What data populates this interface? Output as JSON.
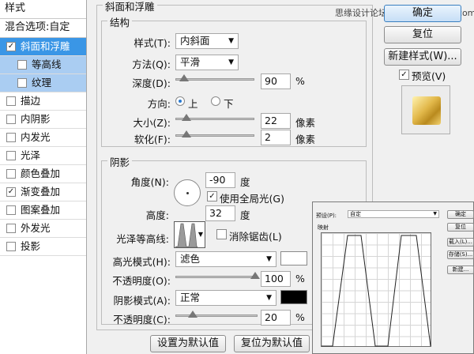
{
  "sidebar": {
    "title": "样式",
    "blend_options": "混合选项:自定",
    "items": [
      {
        "label": "斜面和浮雕",
        "checked": "✓"
      },
      {
        "label": "等高线",
        "checked": ""
      },
      {
        "label": "纹理",
        "checked": ""
      },
      {
        "label": "描边",
        "checked": ""
      },
      {
        "label": "内阴影",
        "checked": ""
      },
      {
        "label": "内发光",
        "checked": ""
      },
      {
        "label": "光泽",
        "checked": ""
      },
      {
        "label": "颜色叠加",
        "checked": ""
      },
      {
        "label": "渐变叠加",
        "checked": "✓"
      },
      {
        "label": "图案叠加",
        "checked": ""
      },
      {
        "label": "外发光",
        "checked": ""
      },
      {
        "label": "投影",
        "checked": ""
      }
    ]
  },
  "bevel": {
    "title": "斜面和浮雕",
    "structure_title": "结构",
    "style_label": "样式(T):",
    "style_value": "内斜面",
    "technique_label": "方法(Q):",
    "technique_value": "平滑",
    "depth_label": "深度(D):",
    "depth_value": "90",
    "depth_unit": "%",
    "direction_label": "方向:",
    "direction_up": "上",
    "direction_down": "下",
    "size_label": "大小(Z):",
    "size_value": "22",
    "size_unit": "像素",
    "soften_label": "软化(F):",
    "soften_value": "2",
    "soften_unit": "像素"
  },
  "shading": {
    "title": "阴影",
    "angle_label": "角度(N):",
    "angle_value": "-90",
    "angle_unit": "度",
    "global_light": "使用全局光(G)",
    "global_light_checked": "✓",
    "altitude_label": "高度:",
    "altitude_value": "32",
    "altitude_unit": "度",
    "gloss_label": "光泽等高线:",
    "antialias": "消除锯齿(L)",
    "highlight_mode_label": "高光模式(H):",
    "highlight_mode_value": "滤色",
    "highlight_color": "#ffffff",
    "highlight_opacity_label": "不透明度(O):",
    "highlight_opacity_value": "100",
    "shadow_mode_label": "阴影模式(A):",
    "shadow_mode_value": "正常",
    "shadow_color": "#000000",
    "shadow_opacity_label": "不透明度(C):",
    "shadow_opacity_value": "20",
    "percent": "%"
  },
  "buttons": {
    "ok": "确定",
    "reset": "复位",
    "new_style": "新建样式(W)...",
    "preview": "预览(V)",
    "preview_checked": "✓",
    "set_default": "设置为默认值",
    "reset_default": "复位为默认值"
  },
  "watermark": "思缘设计论坛 www.missyuan.com",
  "preview_swatch_color": "#e2b84a",
  "curve_editor": {
    "preset_label": "预设(P):",
    "preset_value": "自定",
    "mapping_label": "映射",
    "ok": "确定",
    "reset": "复位",
    "load": "载入(L)...",
    "save": "存储(S)...",
    "new": "新建..."
  }
}
